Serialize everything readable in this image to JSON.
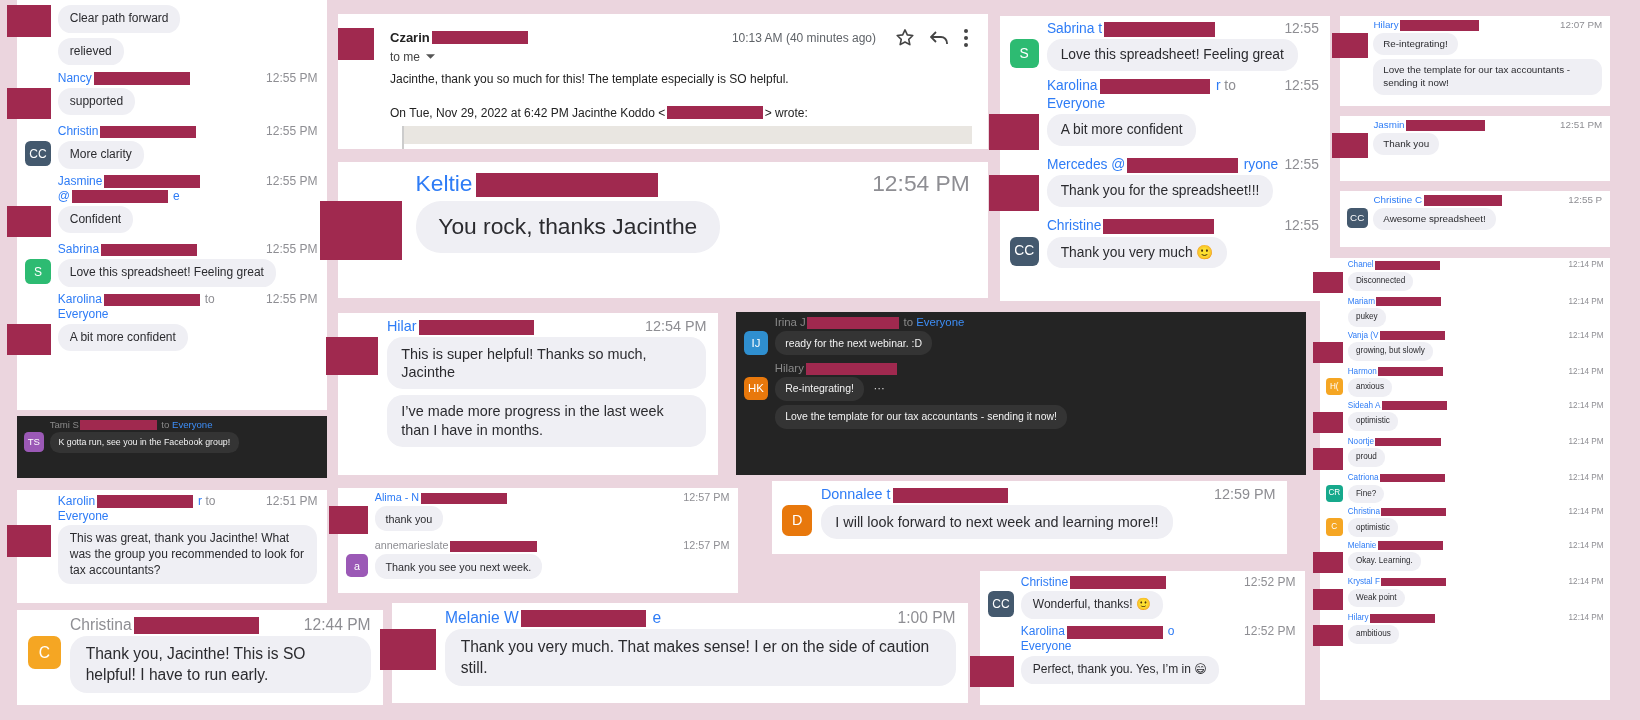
{
  "panels": [
    {
      "kind": "chat",
      "dark": false,
      "messages": [
        {
          "avatar": {
            "kind": "redaction"
          },
          "bubbles": [
            "Clear path forward",
            "relieved"
          ]
        },
        {
          "header": [
            [
              {
                "kind": "link",
                "text": "Nancy"
              },
              {
                "kind": "redaction"
              }
            ]
          ],
          "time": "12:55 PM",
          "avatar": {
            "kind": "redaction"
          },
          "bubbles": [
            "supported"
          ]
        },
        {
          "header": [
            [
              {
                "kind": "link",
                "text": "Christin"
              },
              {
                "kind": "redaction"
              }
            ]
          ],
          "time": "12:55 PM",
          "avatar": {
            "kind": "initials",
            "initials": "CC",
            "color": "#44596e"
          },
          "bubbles": [
            "More clarity"
          ]
        },
        {
          "header": [
            [
              {
                "kind": "link",
                "text": "Jasmine"
              },
              {
                "kind": "redaction"
              }
            ],
            [
              {
                "kind": "link",
                "text": "@"
              },
              {
                "kind": "redaction"
              },
              {
                "kind": "link",
                "text": "e"
              }
            ]
          ],
          "time": "12:55 PM",
          "avatar": {
            "kind": "redaction"
          },
          "bubbles": [
            "Confident"
          ]
        },
        {
          "header": [
            [
              {
                "kind": "link",
                "text": "Sabrina"
              },
              {
                "kind": "redaction"
              }
            ]
          ],
          "time": "12:55 PM",
          "avatar": {
            "kind": "initials",
            "initials": "S",
            "color": "#2dbb72"
          },
          "bubbles": [
            "Love this spreadsheet!  Feeling great"
          ]
        },
        {
          "header": [
            [
              {
                "kind": "link",
                "text": "Karolina"
              },
              {
                "kind": "redaction"
              },
              {
                "kind": "muted",
                "text": "to"
              }
            ],
            [
              {
                "kind": "link",
                "text": "Everyone"
              }
            ]
          ],
          "time": "12:55 PM",
          "avatar": {
            "kind": "redaction"
          },
          "bubbles": [
            "A bit more confident"
          ]
        }
      ]
    },
    {
      "kind": "email",
      "sender": "Czarin",
      "recipient": "to me",
      "time": "10:13 AM (40 minutes ago)",
      "body": "Jacinthe, thank you so much for this! The template especially is SO helpful.",
      "quote_before": "On Tue, Nov 29, 2022 at 6:42 PM Jacinthe Koddo <",
      "quote_after": "> wrote:"
    },
    {
      "kind": "chat",
      "dark": false,
      "messages": [
        {
          "header": [
            [
              {
                "kind": "link",
                "text": "Sabrina t"
              },
              {
                "kind": "redaction"
              }
            ]
          ],
          "time": "12:55",
          "avatar": {
            "kind": "initials",
            "initials": "S",
            "color": "#2dbb72"
          },
          "bubbles": [
            "Love this spreadsheet!  Feeling great"
          ]
        },
        {
          "header": [
            [
              {
                "kind": "link",
                "text": "Karolina"
              },
              {
                "kind": "redaction"
              },
              {
                "kind": "link",
                "text": "r"
              },
              {
                "kind": "muted",
                "text": "to"
              }
            ],
            [
              {
                "kind": "link",
                "text": "Everyone"
              }
            ]
          ],
          "time": "12:55",
          "avatar": {
            "kind": "redaction"
          },
          "bubbles": [
            "A bit more confident"
          ]
        },
        {
          "header": [
            [
              {
                "kind": "link",
                "text": "Mercedes @"
              },
              {
                "kind": "redaction"
              },
              {
                "kind": "link",
                "text": "ryone"
              }
            ]
          ],
          "time": "12:55",
          "avatar": {
            "kind": "redaction"
          },
          "bubbles": [
            "Thank you for the spreadsheet!!!"
          ]
        },
        {
          "header": [
            [
              {
                "kind": "link",
                "text": "Christine"
              },
              {
                "kind": "redaction"
              }
            ]
          ],
          "time": "12:55",
          "avatar": {
            "kind": "initials",
            "initials": "CC",
            "color": "#44596e"
          },
          "bubbles": [
            "Thank you very much 🙂"
          ]
        }
      ]
    },
    {
      "kind": "chat",
      "dark": false,
      "messages": [
        {
          "header": [
            [
              {
                "kind": "link",
                "text": "Hilary"
              },
              {
                "kind": "redaction"
              }
            ]
          ],
          "time": "12:07 PM",
          "avatar": {
            "kind": "redaction"
          },
          "bubbles": [
            "Re-integrating!",
            "Love the template for our tax accountants - sending it now!"
          ]
        }
      ]
    },
    {
      "kind": "chat",
      "dark": false,
      "messages": [
        {
          "header": [
            [
              {
                "kind": "link",
                "text": "Jasmin"
              },
              {
                "kind": "redaction"
              }
            ]
          ],
          "time": "12:51 PM",
          "avatar": {
            "kind": "redaction"
          },
          "bubbles": [
            "Thank you"
          ]
        }
      ]
    },
    {
      "kind": "chat",
      "dark": false,
      "messages": [
        {
          "header": [
            [
              {
                "kind": "link",
                "text": "Keltie"
              },
              {
                "kind": "redaction"
              }
            ]
          ],
          "time": "12:54 PM",
          "avatar": {
            "kind": "redaction"
          },
          "bubbles": [
            "You rock, thanks Jacinthe"
          ]
        }
      ]
    },
    {
      "kind": "chat",
      "dark": false,
      "messages": [
        {
          "header": [
            [
              {
                "kind": "link",
                "text": "Christine C"
              },
              {
                "kind": "redaction"
              }
            ]
          ],
          "time": "12:55 P",
          "avatar": {
            "kind": "initials",
            "initials": "CC",
            "color": "#44596e"
          },
          "bubbles": [
            "Awesome spreadsheet!"
          ]
        }
      ]
    },
    {
      "kind": "chat",
      "dark": false,
      "messages": [
        {
          "header": [
            [
              {
                "kind": "link",
                "text": "Chanel"
              },
              {
                "kind": "redaction"
              }
            ]
          ],
          "time": "12:14 PM",
          "avatar": {
            "kind": "redaction"
          },
          "bubbles": [
            "Disconnected"
          ]
        },
        {
          "header": [
            [
              {
                "kind": "link",
                "text": "Mariam"
              },
              {
                "kind": "redaction"
              }
            ]
          ],
          "time": "12:14 PM",
          "bubbles": [
            "pukey"
          ]
        },
        {
          "header": [
            [
              {
                "kind": "link",
                "text": "Vanja (V"
              },
              {
                "kind": "redaction"
              }
            ]
          ],
          "time": "12:14 PM",
          "avatar": {
            "kind": "redaction"
          },
          "bubbles": [
            "growing, but slowly"
          ]
        },
        {
          "header": [
            [
              {
                "kind": "link",
                "text": "Harmon"
              },
              {
                "kind": "redaction"
              }
            ]
          ],
          "time": "12:14 PM",
          "avatar": {
            "kind": "initials",
            "initials": "H(",
            "color": "#f5a623"
          },
          "bubbles": [
            "anxious"
          ]
        },
        {
          "header": [
            [
              {
                "kind": "link",
                "text": "Sideah A"
              },
              {
                "kind": "redaction"
              }
            ]
          ],
          "time": "12:14 PM",
          "avatar": {
            "kind": "redaction"
          },
          "bubbles": [
            "optimistic"
          ]
        },
        {
          "header": [
            [
              {
                "kind": "link",
                "text": "Noortje"
              },
              {
                "kind": "redaction"
              }
            ]
          ],
          "time": "12:14 PM",
          "avatar": {
            "kind": "redaction"
          },
          "bubbles": [
            "proud"
          ]
        },
        {
          "header": [
            [
              {
                "kind": "link",
                "text": "Catriona"
              },
              {
                "kind": "redaction"
              }
            ]
          ],
          "time": "12:14 PM",
          "avatar": {
            "kind": "initials",
            "initials": "CR",
            "color": "#16a98c"
          },
          "bubbles": [
            "Fine?"
          ]
        },
        {
          "header": [
            [
              {
                "kind": "link",
                "text": "Christina"
              },
              {
                "kind": "redaction"
              }
            ]
          ],
          "time": "12:14 PM",
          "avatar": {
            "kind": "initials",
            "initials": "C",
            "color": "#f5a623"
          },
          "bubbles": [
            "optimistic"
          ]
        },
        {
          "header": [
            [
              {
                "kind": "link",
                "text": "Melanie"
              },
              {
                "kind": "redaction"
              }
            ]
          ],
          "time": "12:14 PM",
          "avatar": {
            "kind": "redaction"
          },
          "bubbles": [
            "Okay.  Learning."
          ]
        },
        {
          "header": [
            [
              {
                "kind": "link",
                "text": "Krystal F"
              },
              {
                "kind": "redaction"
              }
            ]
          ],
          "time": "12:14 PM",
          "avatar": {
            "kind": "redaction"
          },
          "bubbles": [
            "Weak point"
          ]
        },
        {
          "header": [
            [
              {
                "kind": "link",
                "text": "Hilary"
              },
              {
                "kind": "redaction"
              }
            ]
          ],
          "time": "12:14 PM",
          "avatar": {
            "kind": "redaction"
          },
          "bubbles": [
            "ambitious"
          ]
        }
      ]
    },
    {
      "kind": "chat",
      "dark": false,
      "messages": [
        {
          "header": [
            [
              {
                "kind": "link",
                "text": "Hilar"
              },
              {
                "kind": "redaction"
              }
            ]
          ],
          "time": "12:54 PM",
          "avatar": {
            "kind": "redaction"
          },
          "bubbles": [
            "This is super helpful! Thanks so much, Jacinthe",
            "I’ve made more progress in the last week than I have in months."
          ]
        }
      ]
    },
    {
      "kind": "chat",
      "dark": true,
      "messages": [
        {
          "header": [
            [
              {
                "kind": "muted",
                "text": "Irina J"
              },
              {
                "kind": "redaction"
              },
              {
                "kind": "muted",
                "text": "to"
              },
              {
                "kind": "link",
                "text": "Everyone"
              }
            ]
          ],
          "avatar": {
            "kind": "initials",
            "initials": "IJ",
            "color": "#2f8fd0"
          },
          "bubbles": [
            "ready for the next webinar.  :D"
          ]
        },
        {
          "header": [
            [
              {
                "kind": "muted",
                "text": "Hilary"
              },
              {
                "kind": "redaction"
              }
            ]
          ],
          "avatar": {
            "kind": "initials",
            "initials": "HK",
            "color": "#e8780c"
          },
          "bubbles": [
            "Re-integrating!",
            "Love the template for our tax accountants - sending it now!"
          ],
          "more": "···"
        }
      ]
    },
    {
      "kind": "chat",
      "dark": true,
      "messages": [
        {
          "header": [
            [
              {
                "kind": "muted",
                "text": "Tami S"
              },
              {
                "kind": "redaction"
              },
              {
                "kind": "muted",
                "text": "to"
              },
              {
                "kind": "link",
                "text": "Everyone"
              }
            ]
          ],
          "avatar": {
            "kind": "initials",
            "initials": "TS",
            "color": "#9b59b6"
          },
          "bubbles": [
            "K gotta run, see you in the Facebook group!"
          ]
        }
      ]
    },
    {
      "kind": "chat",
      "dark": false,
      "messages": [
        {
          "header": [
            [
              {
                "kind": "link",
                "text": "Karolin"
              },
              {
                "kind": "redaction"
              },
              {
                "kind": "link",
                "text": "r"
              },
              {
                "kind": "muted",
                "text": "to"
              }
            ],
            [
              {
                "kind": "link",
                "text": "Everyone"
              }
            ]
          ],
          "time": "12:51 PM",
          "avatar": {
            "kind": "redaction"
          },
          "bubbles": [
            "This was great, thank you Jacinthe! What was the group you recommended to look for tax accountants?"
          ]
        }
      ]
    },
    {
      "kind": "chat",
      "dark": false,
      "messages": [
        {
          "header": [
            [
              {
                "kind": "link",
                "text": "Alima - N"
              },
              {
                "kind": "redaction"
              }
            ]
          ],
          "time": "12:57 PM",
          "avatar": {
            "kind": "redaction"
          },
          "bubbles": [
            "thank you"
          ]
        },
        {
          "header": [
            [
              {
                "kind": "muted",
                "text": "annemarieslate"
              },
              {
                "kind": "redaction"
              }
            ]
          ],
          "time": "12:57 PM",
          "avatar": {
            "kind": "initials",
            "initials": "a",
            "color": "#9b59b6"
          },
          "bubbles": [
            "Thank you see you next week."
          ]
        }
      ]
    },
    {
      "kind": "chat",
      "dark": false,
      "messages": [
        {
          "header": [
            [
              {
                "kind": "link",
                "text": "Donnalee t"
              },
              {
                "kind": "redaction"
              }
            ]
          ],
          "time": "12:59 PM",
          "avatar": {
            "kind": "initials",
            "initials": "D",
            "color": "#e8780c"
          },
          "bubbles": [
            "I will look forward to next week and learning more!!"
          ]
        }
      ]
    },
    {
      "kind": "chat",
      "dark": false,
      "messages": [
        {
          "header": [
            [
              {
                "kind": "muted",
                "text": "Christina"
              },
              {
                "kind": "redaction"
              }
            ]
          ],
          "time": "12:44 PM",
          "avatar": {
            "kind": "initials",
            "initials": "C",
            "color": "#f5a623"
          },
          "bubbles": [
            "Thank you, Jacinthe! This is SO helpful! I have to run early."
          ]
        }
      ]
    },
    {
      "kind": "chat",
      "dark": false,
      "messages": [
        {
          "header": [
            [
              {
                "kind": "link",
                "text": "Melanie W"
              },
              {
                "kind": "redaction"
              },
              {
                "kind": "link",
                "text": "e"
              }
            ]
          ],
          "time": "1:00 PM",
          "avatar": {
            "kind": "redaction"
          },
          "bubbles": [
            "Thank you very much.  That makes sense! I er on the side of caution still."
          ]
        }
      ]
    },
    {
      "kind": "chat",
      "dark": false,
      "messages": [
        {
          "header": [
            [
              {
                "kind": "link",
                "text": "Christine"
              },
              {
                "kind": "redaction"
              }
            ]
          ],
          "time": "12:52 PM",
          "avatar": {
            "kind": "initials",
            "initials": "CC",
            "color": "#44596e"
          },
          "bubbles": [
            "Wonderful, thanks! 🙂"
          ]
        },
        {
          "header": [
            [
              {
                "kind": "link",
                "text": "Karolina"
              },
              {
                "kind": "redaction"
              },
              {
                "kind": "link",
                "text": "o"
              }
            ],
            [
              {
                "kind": "link",
                "text": "Everyone"
              }
            ]
          ],
          "time": "12:52 PM",
          "avatar": {
            "kind": "redaction"
          },
          "bubbles": [
            "Perfect, thank you. Yes, I’m in 😄"
          ]
        }
      ]
    }
  ]
}
